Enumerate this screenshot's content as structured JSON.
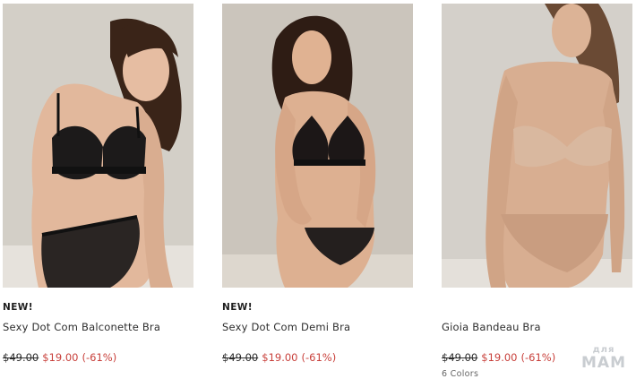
{
  "products": [
    {
      "badge": "NEW!",
      "title": "Sexy Dot Com Balconette Bra",
      "old_price": "$49.00",
      "new_price": "$19.00",
      "discount": "(-61%)",
      "colors": ""
    },
    {
      "badge": "NEW!",
      "title": "Sexy Dot Com Demi Bra",
      "old_price": "$49.00",
      "new_price": "$19.00",
      "discount": "(-61%)",
      "colors": ""
    },
    {
      "badge": "",
      "title": "Gioia Bandeau Bra",
      "old_price": "$49.00",
      "new_price": "$19.00",
      "discount": "(-61%)",
      "colors": "6 Colors"
    }
  ],
  "watermark": {
    "line1": "для",
    "line2": "МАМ"
  },
  "colors": {
    "sale": "#c8403b",
    "text": "#2b2b2b"
  }
}
